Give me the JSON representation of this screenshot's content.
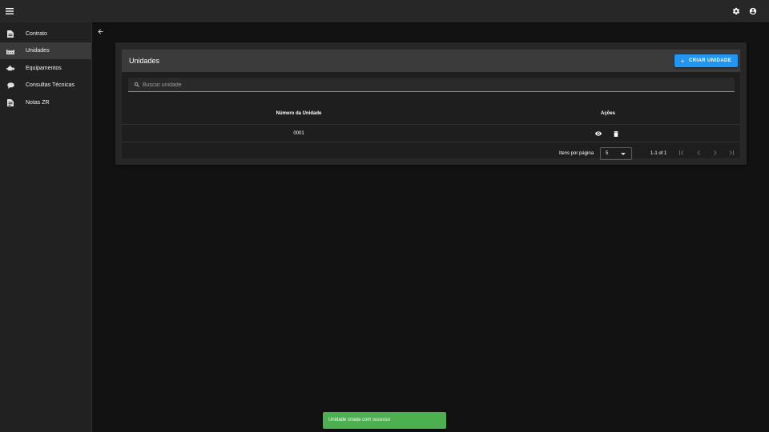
{
  "topbar": {
    "menu_icon": "menu-icon",
    "settings_icon": "gear-icon",
    "account_icon": "account-circle-icon"
  },
  "sidebar": {
    "items": [
      {
        "label": "Contrato",
        "icon": "document-icon",
        "active": false
      },
      {
        "label": "Unidades",
        "icon": "factory-icon",
        "active": true
      },
      {
        "label": "Equipamentos",
        "icon": "equipment-icon",
        "active": false
      },
      {
        "label": "Consultas Técnicas",
        "icon": "chat-bubble-icon",
        "active": false
      },
      {
        "label": "Notas ZR",
        "icon": "note-icon",
        "active": false
      }
    ]
  },
  "main": {
    "back_icon": "arrow-left-icon",
    "title": "Unidades",
    "create_button": {
      "label": "CRIAR UNIDADE",
      "icon": "plus-icon"
    },
    "search": {
      "placeholder": "Buscar unidade",
      "value": ""
    },
    "table": {
      "columns": [
        "Número da Unidade",
        "Ações"
      ],
      "rows": [
        {
          "numero": "0001",
          "actions": [
            "eye-icon",
            "trash-icon"
          ]
        }
      ]
    },
    "pagination": {
      "items_per_page_label": "Itens por página",
      "items_per_page": "5",
      "range": "1-1 of 1"
    }
  },
  "snackbar": {
    "message": "Unidade criada com sucesso"
  },
  "colors": {
    "accent": "#2196f3",
    "success": "#4caf50",
    "background": "#121212",
    "appbar": "#272727"
  }
}
